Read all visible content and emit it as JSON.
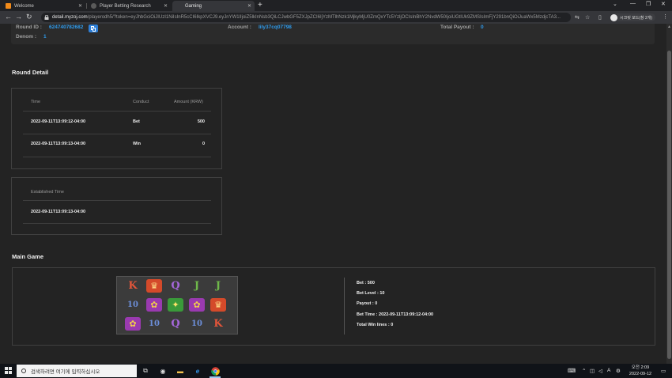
{
  "browser": {
    "tabs": [
      {
        "label": "Welcome",
        "favicon_color": "#f28b1a"
      },
      {
        "label": "Player Betting Research",
        "favicon_color": "#5a5a5a"
      },
      {
        "label": "Gaming",
        "favicon_color": "#5a5a5a"
      }
    ],
    "url_host": "detail.myzoj.com",
    "url_rest": "/playerodh5/?token=eyJhbGciOiJIUzI1NiIsInR5cCI6IkpXVCJ9.eyJnYW1lIjoiZ5lkInNsb3QiLCJwbGF5ZXJpZCI6IjYzMTlhNzk1MjkyMjU0ZmQxYTc5YzljOCIsInBhY2NvdW50IjoiUGtlUk9ZMSIsImFjY291bnQiOiJuaWx5MzdjcTA3...",
    "profile_label": "시크릿 모드(창 2개)"
  },
  "round_info": {
    "round_id_label": "Round ID :",
    "round_id": "624740782682",
    "account_label": "Account :",
    "account": "lily37cq07798",
    "total_payout_label": "Total Payout :",
    "total_payout": "0",
    "denom_label": "Denom :",
    "denom": "1"
  },
  "round_detail": {
    "title": "Round Detail",
    "columns": [
      "Time",
      "Conduct",
      "Amount (KRW)"
    ],
    "rows": [
      {
        "time": "2022-09-11T13:09:12-04:00",
        "conduct": "Bet",
        "amount": "500"
      },
      {
        "time": "2022-09-11T13:09:13-04:00",
        "conduct": "Win",
        "amount": "0"
      }
    ],
    "established_label": "Established Time",
    "established_time": "2022-09-11T13:09:13-04:00"
  },
  "main_game": {
    "title": "Main Game",
    "grid": [
      [
        "K",
        "CROWN",
        "Q",
        "J",
        "J"
      ],
      [
        "10",
        "FLOWER",
        "FROG",
        "FLOWER",
        "CROWN"
      ],
      [
        "FLOWER",
        "10",
        "Q",
        "10",
        "K"
      ]
    ],
    "info": {
      "bet": "Bet : 500",
      "bet_level": "Bet Level : 10",
      "payout": "Payout : 0",
      "bet_time": "Bet Time : 2022-09-11T13:09:12-04:00",
      "total_win_lines": "Total Win lines : 0"
    }
  },
  "taskbar": {
    "search_placeholder": "검색하려면 여기에 입력하십시오",
    "time": "오전 2:09",
    "date": "2022-09-12",
    "ime": "A"
  }
}
